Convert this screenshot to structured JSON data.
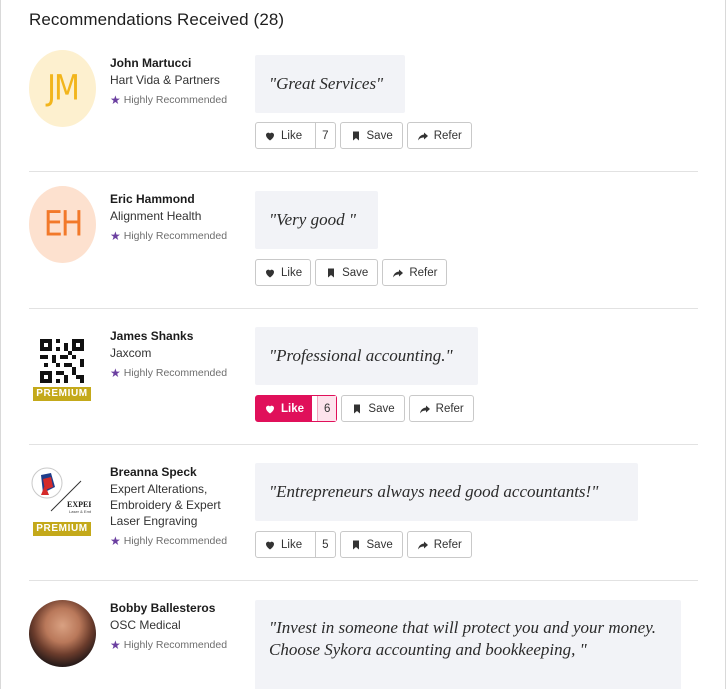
{
  "header": {
    "title": "Recommendations Received (28)"
  },
  "buttons": {
    "like": "Like",
    "save": "Save",
    "refer": "Refer"
  },
  "recommendations": [
    {
      "initials": "JM",
      "name": "John Martucci",
      "company": "Hart Vida & Partners",
      "badge": "Highly Recommended",
      "quote": "\"Great Services\"",
      "like_count": "7",
      "liked": false,
      "premium": ""
    },
    {
      "initials": "EH",
      "name": "Eric Hammond",
      "company": "Alignment Health",
      "badge": "Highly Recommended",
      "quote": "\"Very good \"",
      "like_count": "",
      "liked": false,
      "premium": ""
    },
    {
      "initials": "",
      "name": "James Shanks",
      "company": "Jaxcom",
      "badge": "Highly Recommended",
      "quote": "\"Professional accounting.\"",
      "like_count": "6",
      "liked": true,
      "premium": "PREMIUM"
    },
    {
      "initials": "",
      "name": "Breanna Speck",
      "company": "Expert Alterations, Embroidery & Expert Laser Engraving",
      "badge": "Highly Recommended",
      "quote": "\"Entrepreneurs always need good accountants!\"",
      "like_count": "5",
      "liked": false,
      "premium": "PREMIUM"
    },
    {
      "initials": "",
      "name": "Bobby Ballesteros",
      "company": "OSC Medical",
      "badge": "Highly Recommended",
      "quote": "\"Invest in someone that will protect you and your money. Choose Sykora accounting and bookkeeping, \"",
      "like_count": "",
      "liked": false,
      "premium": ""
    }
  ],
  "colors": {
    "accent_like": "#e0105a",
    "badge_star": "#6b3fa0",
    "premium": "#c4a91a"
  }
}
